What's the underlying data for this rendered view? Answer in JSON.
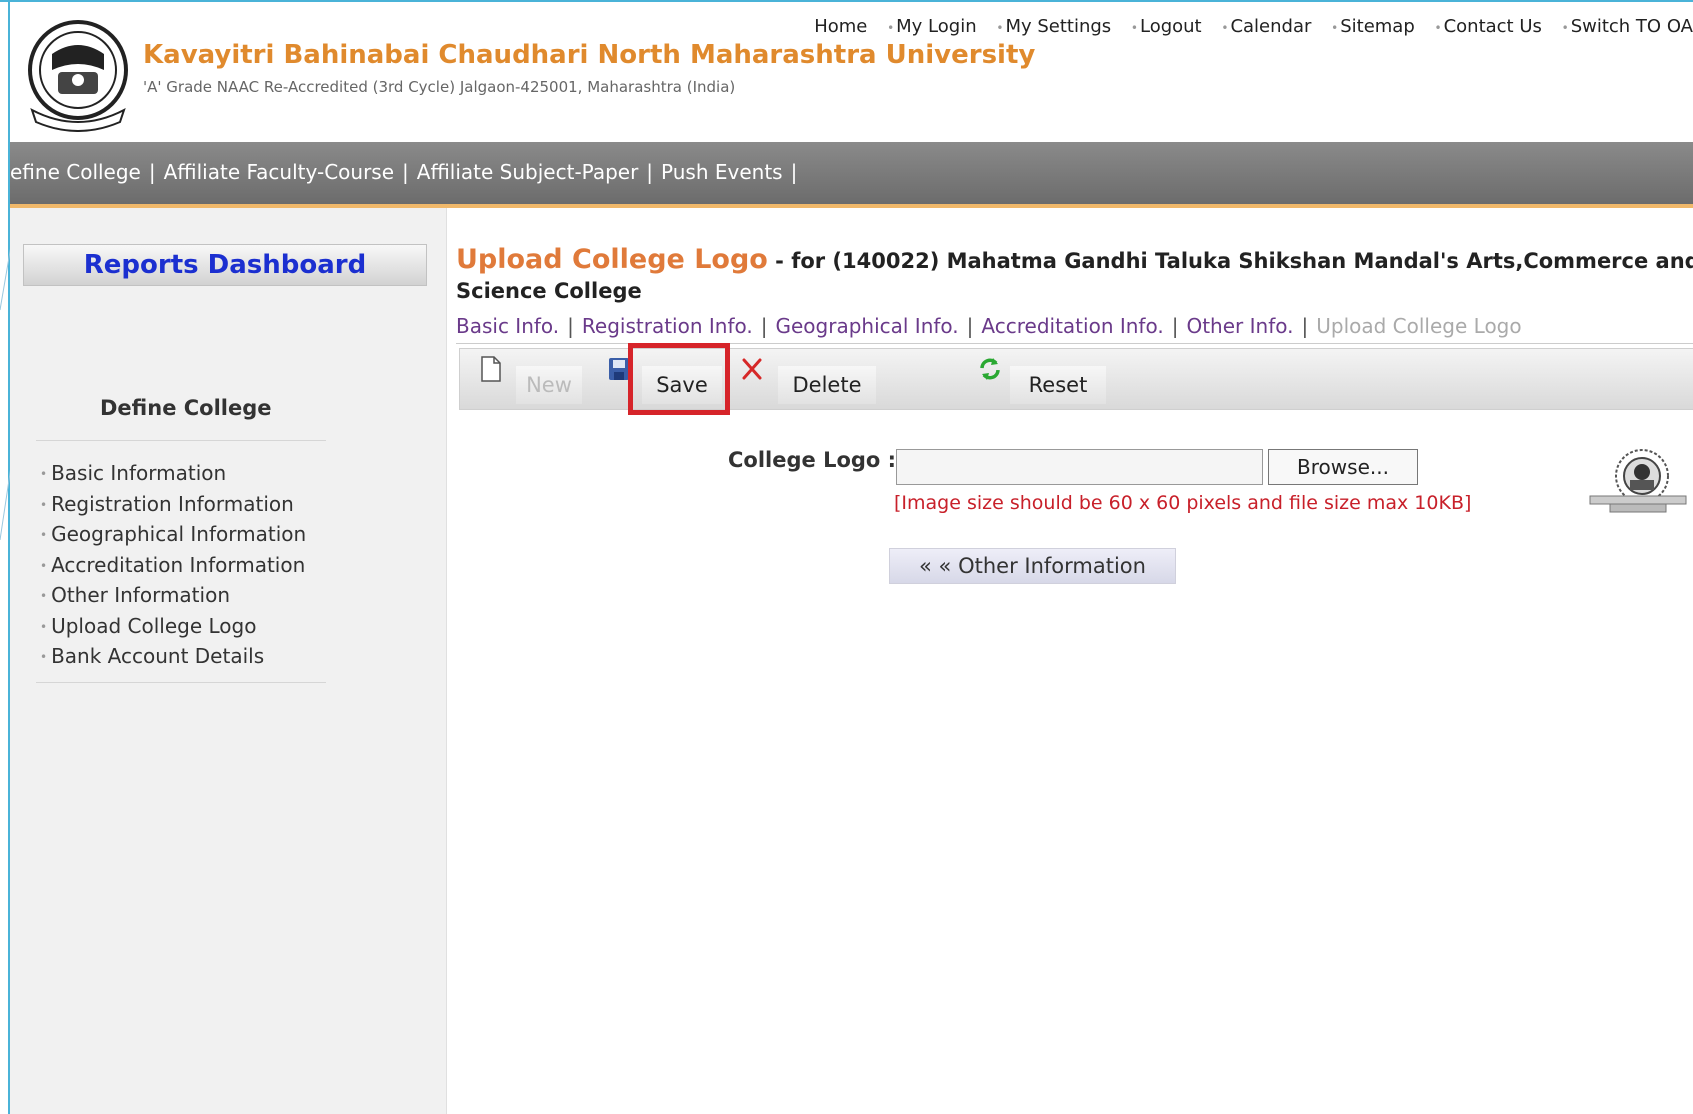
{
  "header": {
    "university_name": "Kavayitri Bahinabai Chaudhari North Maharashtra University",
    "subtitle": "'A' Grade NAAC Re-Accredited (3rd Cycle) Jalgaon-425001, Maharashtra (India)",
    "top_links": [
      "Home",
      "My Login",
      "My Settings",
      "Logout",
      "Calendar",
      "Sitemap",
      "Contact Us",
      "Switch TO OA"
    ]
  },
  "navbar": {
    "items": [
      "efine College",
      "Affiliate Faculty-Course",
      "Affiliate Subject-Paper",
      "Push Events"
    ],
    "separator": "|"
  },
  "sidebar": {
    "reports_button": "Reports Dashboard",
    "section_title": "Define College",
    "items": [
      "Basic Information",
      "Registration Information",
      "Geographical Information",
      "Accreditation Information",
      "Other Information",
      "Upload College Logo",
      "Bank Account Details"
    ]
  },
  "main": {
    "title": "Upload College Logo",
    "title_for": " - for (140022) Mahatma Gandhi Taluka Shikshan Mandal's Arts,Commerce and",
    "title_line2": "Science College",
    "tabs": [
      {
        "label": "Basic Info."
      },
      {
        "label": "Registration Info."
      },
      {
        "label": "Geographical Info."
      },
      {
        "label": "Accreditation Info."
      },
      {
        "label": "Other Info."
      },
      {
        "label": "Upload College Logo"
      }
    ],
    "toolbar": {
      "new_label": "New",
      "save_label": "Save",
      "delete_label": "Delete",
      "reset_label": "Reset"
    },
    "form": {
      "college_logo_label": "College Logo :",
      "file_value": "",
      "browse_label": "Browse...",
      "hint": "[Image size should be 60 x 60 pixels and file size max 10KB]",
      "other_info_button": "« « Other Information"
    }
  },
  "colors": {
    "brand_orange": "#e08a2d",
    "title_orange": "#e07a3a",
    "link_purple": "#6a3a8a",
    "reports_blue": "#1b2fd0",
    "hint_red": "#c8202a",
    "highlight_red": "#d6242a"
  }
}
